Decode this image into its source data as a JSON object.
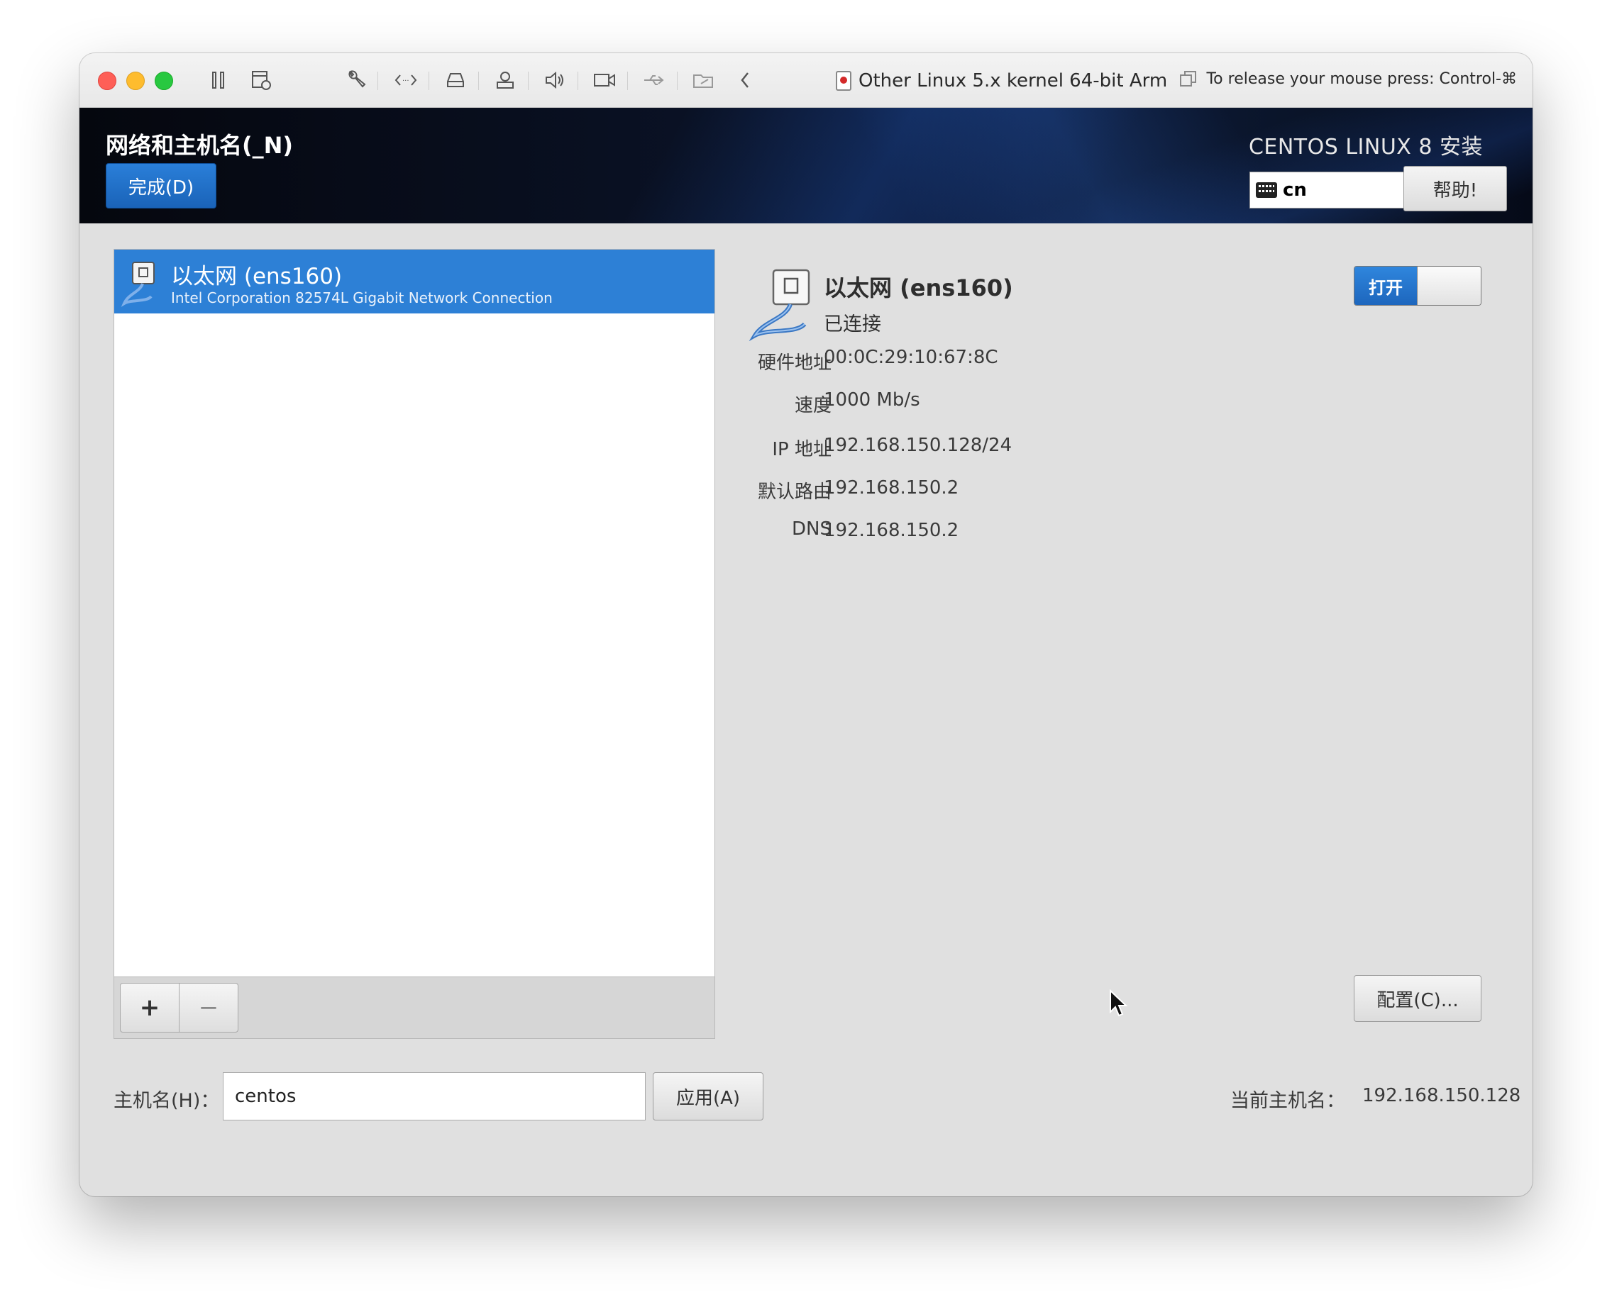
{
  "vm_window": {
    "title": "Other Linux 5.x kernel 64-bit Arm",
    "release_hint": "To release your mouse press: Control-⌘",
    "toolbar_icons": [
      "pause-icon",
      "snapshot-icon",
      "wrench-icon",
      "code-icon",
      "disk-icon",
      "printer-icon",
      "speaker-icon",
      "camera-icon",
      "usb-icon",
      "shared-folder-icon",
      "back-icon"
    ]
  },
  "header": {
    "spoke_title": "网络和主机名(_N)",
    "done_label": "完成(D)",
    "product_title": "CENTOS LINUX 8 安装",
    "keyboard_layout": "cn",
    "help_label": "帮助!"
  },
  "device_list": {
    "items": [
      {
        "name": "以太网 (ens160)",
        "description": "Intel Corporation 82574L Gigabit Network Connection",
        "selected": true
      }
    ],
    "add_label": "+",
    "remove_label": "−"
  },
  "details": {
    "name": "以太网 (ens160)",
    "status": "已连接",
    "switch_label": "打开",
    "switch_on": true,
    "fields": [
      {
        "label": "硬件地址",
        "value": "00:0C:29:10:67:8C"
      },
      {
        "label": "速度",
        "value": "1000 Mb/s"
      },
      {
        "label": "IP 地址",
        "value": "192.168.150.128/24"
      },
      {
        "label": "默认路由",
        "value": "192.168.150.2"
      },
      {
        "label": "DNS",
        "value": "192.168.150.2"
      }
    ],
    "configure_label": "配置(C)..."
  },
  "hostname": {
    "label": "主机名(H)：",
    "value": "centos",
    "apply_label": "应用(A)",
    "current_label": "当前主机名：",
    "current_value": "192.168.150.128"
  },
  "colors": {
    "selection_blue": "#2d80d6",
    "header_dark": "#0a1226",
    "panel_gray": "#e0e0e0"
  }
}
